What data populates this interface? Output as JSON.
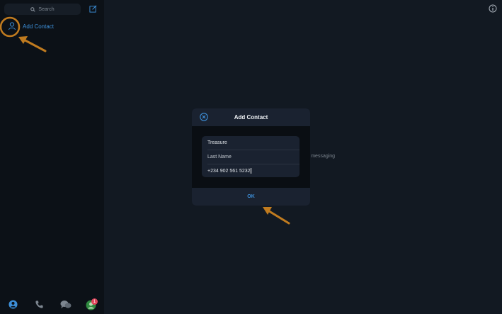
{
  "sidebar": {
    "search_placeholder": "Search",
    "add_contact_label": "Add Contact",
    "badge_count": "1"
  },
  "main": {
    "hint_text": "rt messaging"
  },
  "modal": {
    "title": "Add Contact",
    "first_name_value": "Treasure",
    "last_name_placeholder": "Last Name",
    "phone_value": "+234 902 561 5232",
    "ok_label": "OK"
  },
  "colors": {
    "accent": "#3d8fd8",
    "annotation": "#c07b1f",
    "badge": "#e0465b"
  },
  "icons": [
    "search-icon",
    "compose-icon",
    "person-icon",
    "contacts-icon",
    "phone-icon",
    "chats-icon",
    "info-icon",
    "close-icon"
  ]
}
